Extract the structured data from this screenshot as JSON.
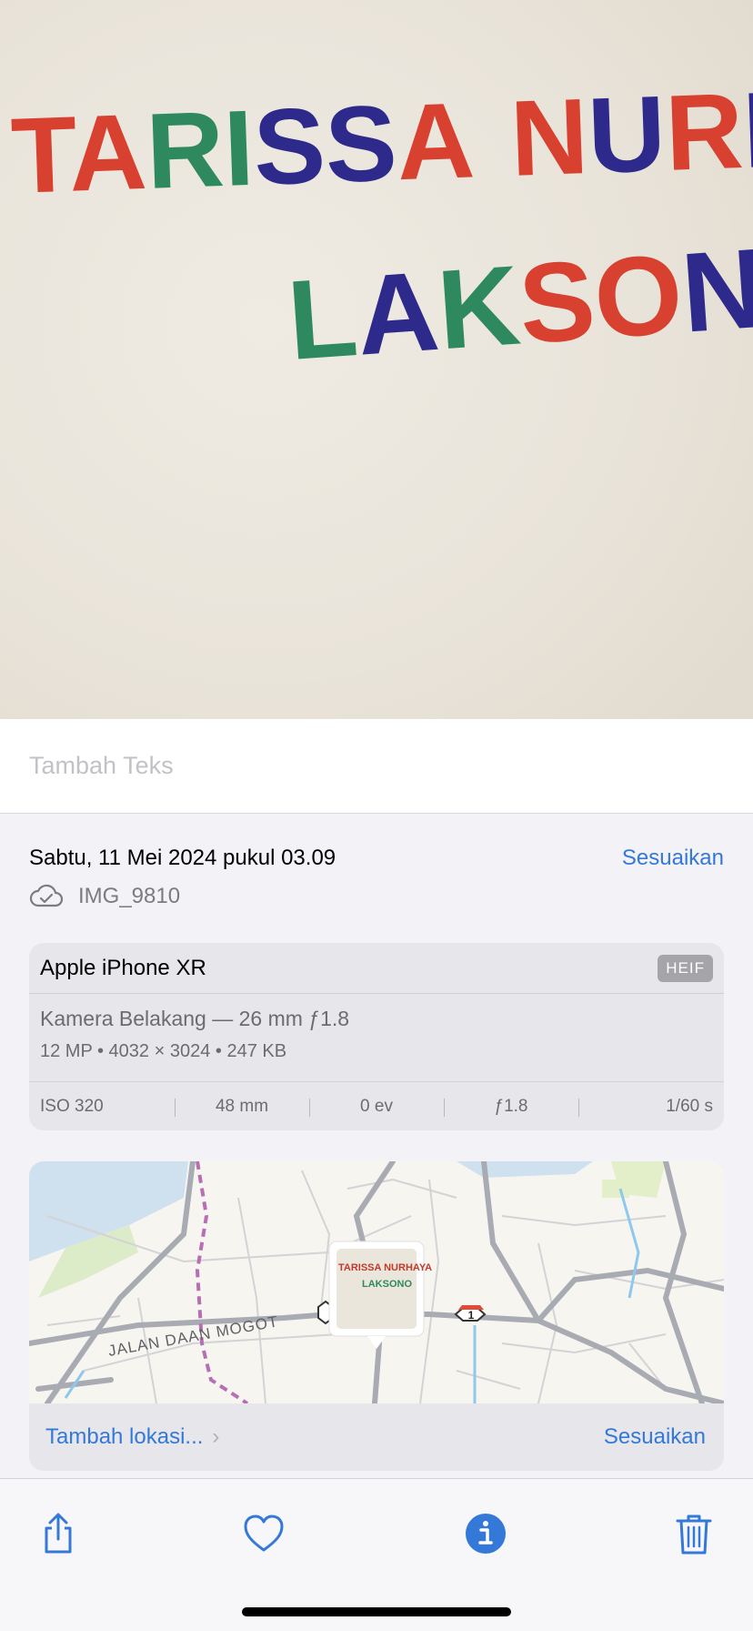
{
  "photo": {
    "handwriting_line1": "TARISSA NURHA",
    "handwriting_line2": "LAKSONO",
    "thumb_line1": "TARISSA NURHAYA",
    "thumb_line2": "LAKSONO"
  },
  "caption": {
    "placeholder": "Tambah Teks",
    "value": ""
  },
  "meta": {
    "datetime": "Sabtu, 11 Mei 2024 pukul 03.09",
    "adjust_label": "Sesuaikan",
    "file_name": "IMG_9810",
    "cloud_icon": "icloud-check-icon"
  },
  "device": {
    "name": "Apple iPhone XR",
    "format": "HEIF",
    "lens": "Kamera Belakang — 26 mm ƒ1.8",
    "specs": "12 MP  •  4032 × 3024  •  247 KB",
    "exif": [
      "ISO 320",
      "48 mm",
      "0 ev",
      "ƒ1.8",
      "1/60 s"
    ]
  },
  "map": {
    "street_label": "JALAN DAAN MOGOT",
    "route_number": "1",
    "add_location_label": "Tambah lokasi...",
    "adjust_label": "Sesuaikan"
  },
  "toolbar": {
    "icons": [
      "share-icon",
      "heart-icon",
      "info-icon",
      "trash-icon"
    ],
    "accent": "#3478d8"
  },
  "colors": {
    "accent": "#3478d8",
    "muted": "#6c6c70",
    "background": "#f2f2f7"
  }
}
